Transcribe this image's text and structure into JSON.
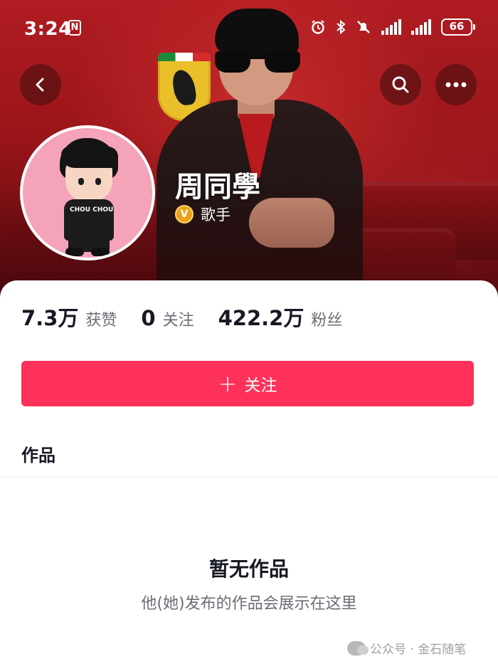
{
  "status_bar": {
    "time": "3:24",
    "nfc_label": "N",
    "battery": "66"
  },
  "header": {
    "back_icon": "chevron-left-icon",
    "search_icon": "search-icon",
    "more_icon": "more-horizontal-icon"
  },
  "profile": {
    "name": "周同學",
    "verify_badge": "V",
    "verified_title": "歌手",
    "avatar_shirt_text": "CHOU CHOU"
  },
  "stats": [
    {
      "value": "7.3万",
      "label": "获赞"
    },
    {
      "value": "0",
      "label": "关注"
    },
    {
      "value": "422.2万",
      "label": "粉丝"
    }
  ],
  "follow_button": {
    "icon": "+",
    "label": "关注",
    "color": "#fd3159"
  },
  "tabs": {
    "works_label": "作品"
  },
  "empty_state": {
    "title": "暂无作品",
    "subtitle": "他(她)发布的作品会展示在这里"
  },
  "watermark": {
    "text": "公众号 · 金石随笔"
  }
}
